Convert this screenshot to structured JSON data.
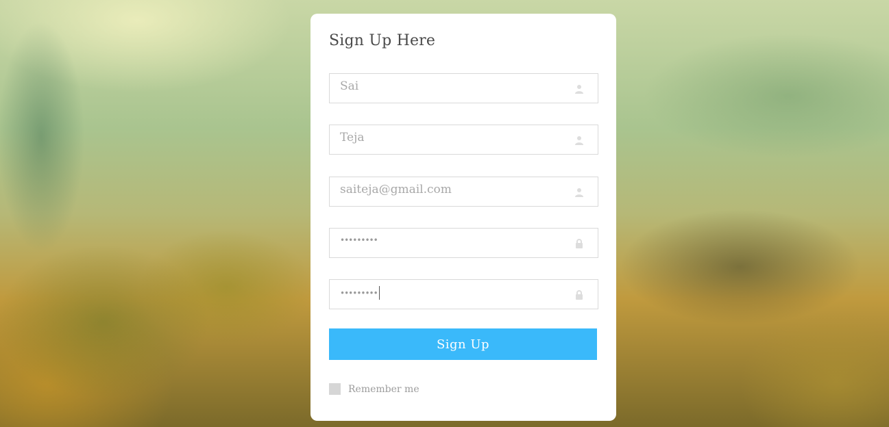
{
  "form": {
    "title": "Sign Up Here",
    "fields": [
      {
        "value": "Sai",
        "icon": "user-icon",
        "type": "text"
      },
      {
        "value": "Teja",
        "icon": "user-icon",
        "type": "text"
      },
      {
        "value": "saiteja@gmail.com",
        "icon": "user-icon",
        "type": "text"
      },
      {
        "value": "•••••••••",
        "icon": "lock-icon",
        "type": "password"
      },
      {
        "value": "•••••••••",
        "icon": "lock-icon",
        "type": "password"
      }
    ],
    "submit_label": "Sign Up",
    "remember_label": "Remember me"
  },
  "colors": {
    "accent": "#3ab9fa",
    "card": "#ffffff",
    "field_border": "#d9d9d9",
    "icon": "#dddddd"
  }
}
